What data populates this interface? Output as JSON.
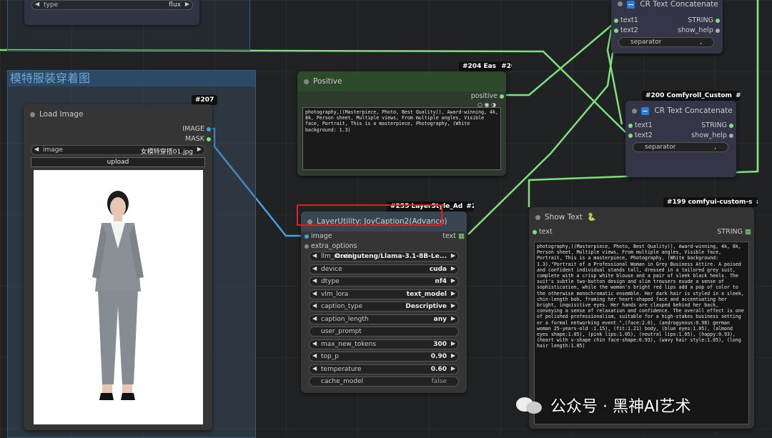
{
  "top_left_node": {
    "widget": {
      "label": "type",
      "value": "flux"
    }
  },
  "group": {
    "title": "模特服装穿着图"
  },
  "load_image": {
    "tag": "#207",
    "title": "Load Image",
    "outputs": [
      "IMAGE",
      "MASK"
    ],
    "image_widget": {
      "label": "image",
      "value": "女模特穿搭01.jpg"
    },
    "upload_label": "upload"
  },
  "positive": {
    "tag": "#204 Eas",
    "tag2": "#204",
    "title": "Positive",
    "output": "positive",
    "text": "photography,((Masterpiece, Photo, Best Quality)), Award-winning, 4k, 8k, Person sheet, Multiple views, From multiple angles, Visible face, Portrait, This is a masterpiece, Photography, (White background: 1.3)"
  },
  "cr_top": {
    "title": "CR Text Concatenate",
    "inputs": [
      "text1",
      "text2"
    ],
    "outputs": [
      "STRING",
      "show_help"
    ],
    "separator": {
      "label": "separator",
      "value": ","
    }
  },
  "cr_mid": {
    "tag": "#200 Comfyroll_Custom",
    "tag2": "#200",
    "title": "CR Text Concatenate",
    "inputs": [
      "text1",
      "text2"
    ],
    "outputs": [
      "STRING",
      "show_help"
    ],
    "separator": {
      "label": "separator",
      "value": ","
    }
  },
  "joycaption": {
    "tag": "#255 LayerStyle_Ad",
    "tag2": "#255",
    "title": "LayerUtility: JoyCaption2(Advance)",
    "inputs": [
      "image",
      "extra_options"
    ],
    "output": "text",
    "widgets": [
      {
        "label": "llm_model",
        "value": "Orenguteng/Llama-3.1-8B-Le..."
      },
      {
        "label": "device",
        "value": "cuda"
      },
      {
        "label": "dtype",
        "value": "nf4"
      },
      {
        "label": "vlm_lora",
        "value": "text_model"
      },
      {
        "label": "caption_type",
        "value": "Descriptive"
      },
      {
        "label": "caption_length",
        "value": "any"
      },
      {
        "label": "user_prompt",
        "value": ""
      },
      {
        "label": "max_new_tokens",
        "value": "300"
      },
      {
        "label": "top_p",
        "value": "0.90"
      },
      {
        "label": "temperature",
        "value": "0.60"
      },
      {
        "label": "cache_model",
        "value": "false"
      }
    ]
  },
  "show_text": {
    "tag": "#199 comfyui-custom-s",
    "tag2": "#199",
    "title": "Show Text",
    "icon": "snake-icon",
    "input": "text",
    "output": "STRING",
    "text": "photography,((Masterpiece, Photo, Best Quality)), Award-winning, 4k, 8k, Person sheet, Multiple views, From multiple angles, Visible face, Portrait, This is a masterpiece, Photography, (White background: 1.3),\"Portrait of a Professional Woman in Grey Business Attire. A poised and confident individual stands tall, dressed in a tailored grey suit, complete with a crisp white blouse and a pair of sleek black heels. The suit's subtle two-button design and slim trousers exude a sense of sophistication, while the woman's bright red lips add a pop of color to the otherwise monochromatic ensemble. Her dark hair is styled in a sleek, chin-length bob, framing her heart-shaped face and accentuating her bright, inquisitive eyes. Her hands are clasped behind her back, conveying a sense of relaxation and confidence. The overall effect is one of polished professionalism, suitable for a high-stakes business setting or a formal networking event.\",(face:2.0), (androgynous:0.98) german woman 25-years-old :1.15), (fit:1.21) body, (blue eyes:1.05), (almond eyes shape:1.05), (pink lips:1.05), (neutral lips:1.05), (happy:0.93), (heart with v-shape chin face-shape:0.93), (wavy hair style:1.05), (long hair length:1.05)"
  },
  "watermark": {
    "text": "公众号 · 黑神AI艺术"
  },
  "colors": {
    "link_green": "#7ee07e",
    "link_blue": "#4a9fe0",
    "highlight_red": "#e02020"
  }
}
